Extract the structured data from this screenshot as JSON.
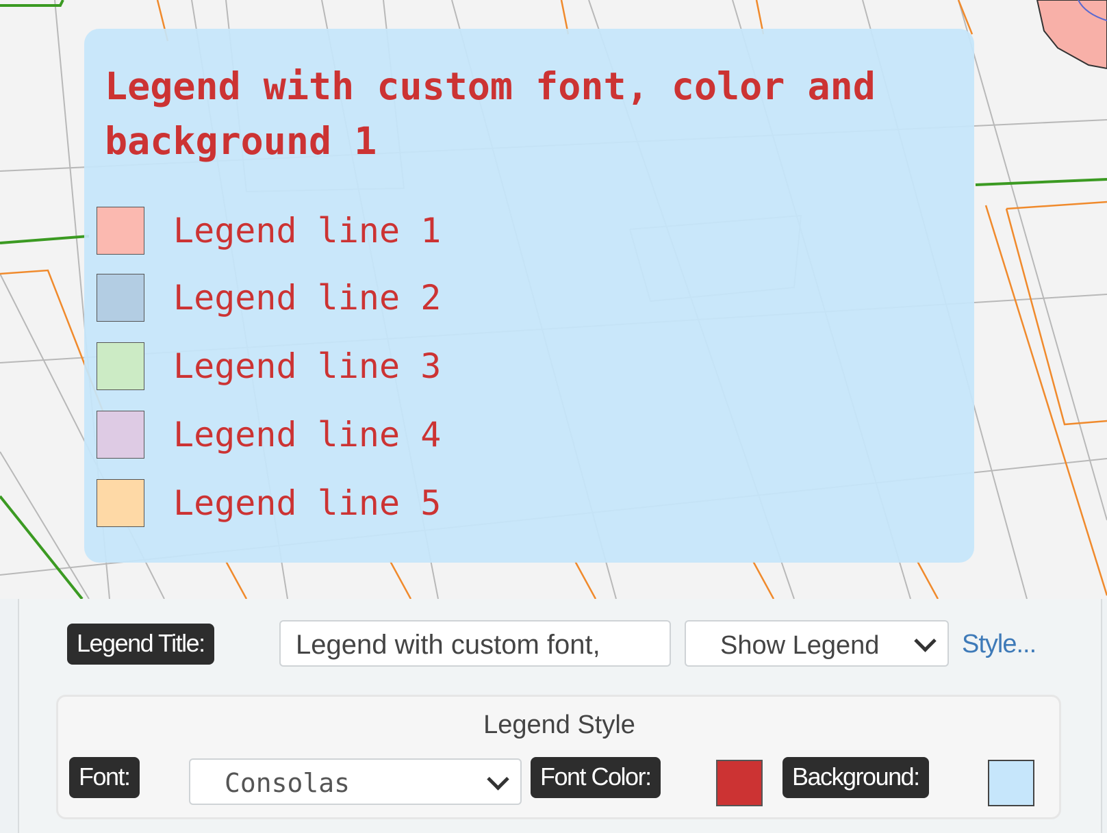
{
  "legend": {
    "title": "Legend with custom font, color and background 1",
    "font_color": "#cc3333",
    "background_color": "#c6e6fb",
    "items": [
      {
        "label": "Legend line 1",
        "color": "#fbb9b0"
      },
      {
        "label": "Legend line 2",
        "color": "#b3cde3"
      },
      {
        "label": "Legend line 3",
        "color": "#ccebc5"
      },
      {
        "label": "Legend line 4",
        "color": "#decbe4"
      },
      {
        "label": "Legend line 5",
        "color": "#fed9a6"
      }
    ]
  },
  "controls": {
    "legend_title_label": "Legend Title:",
    "legend_title_value": "Legend with custom font,",
    "show_legend_value": "Show Legend",
    "style_link": "Style...",
    "style_section": {
      "heading": "Legend Style",
      "font_label": "Font:",
      "font_value": "Consolas",
      "font_color_label": "Font Color:",
      "font_color_value": "#cc3333",
      "background_label": "Background:",
      "background_value": "#c6e6fb"
    }
  }
}
